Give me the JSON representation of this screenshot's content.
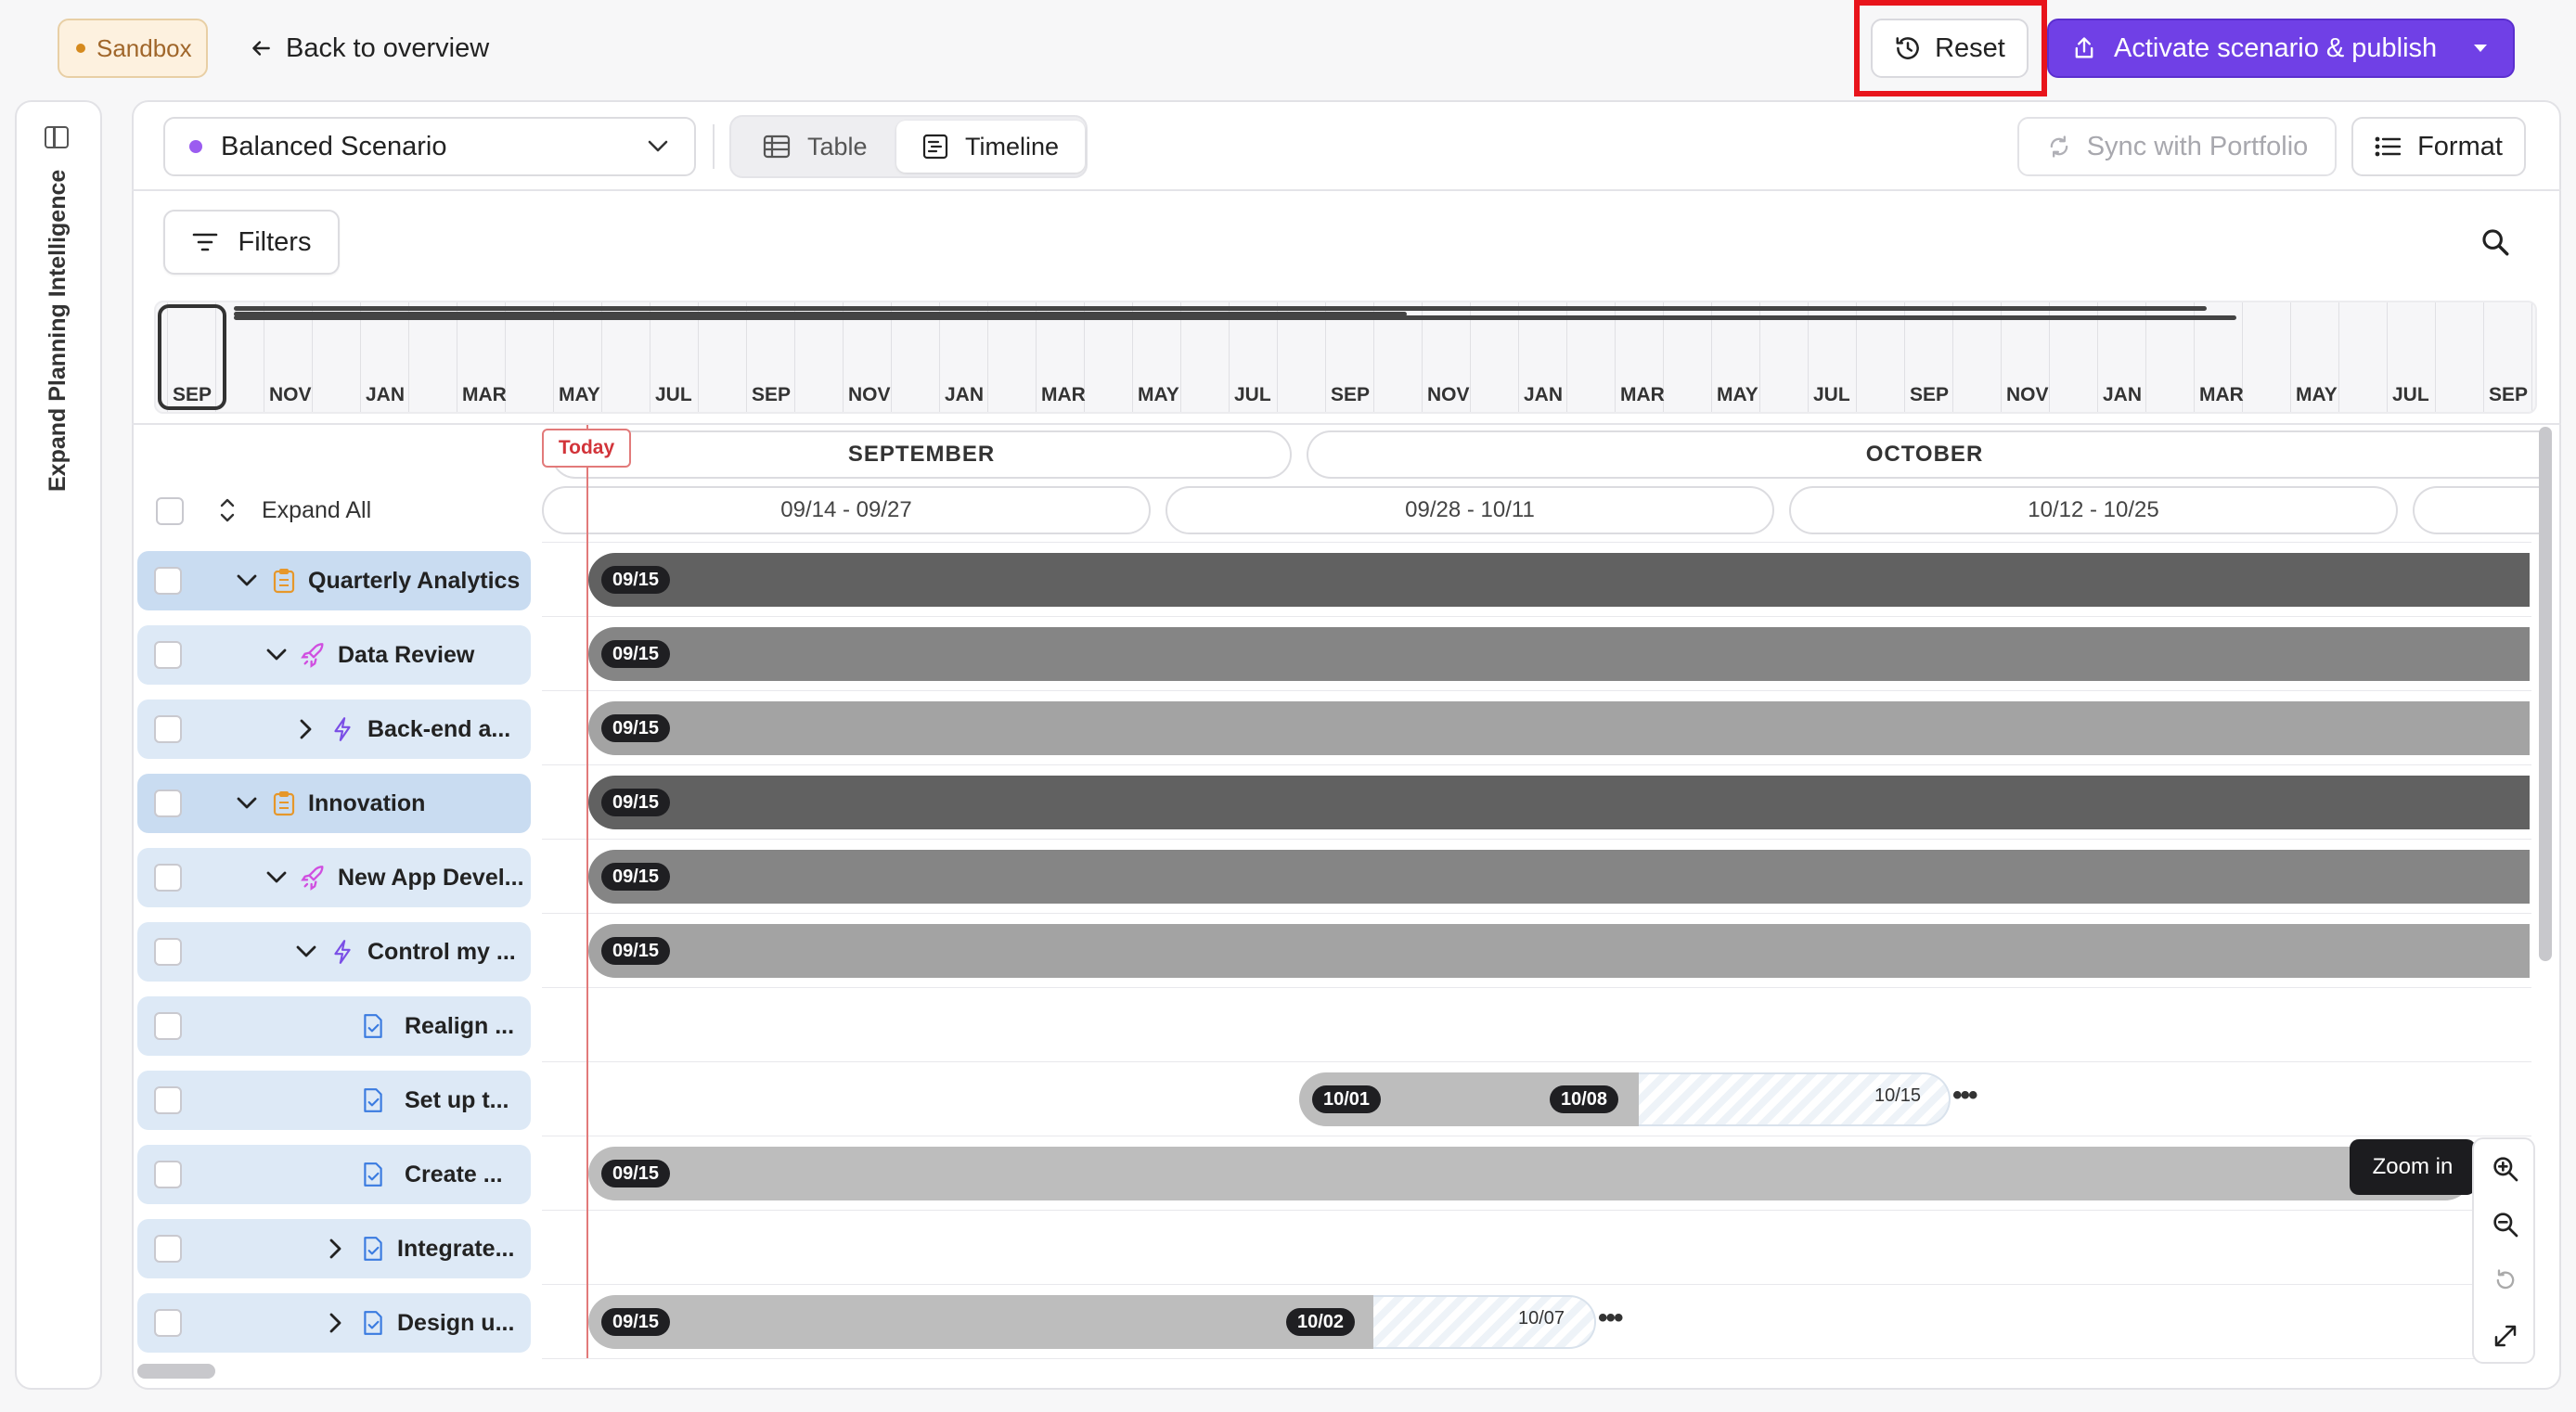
{
  "topbar": {
    "sandbox_label": "Sandbox",
    "back_label": "Back to overview",
    "reset_label": "Reset",
    "activate_label": "Activate scenario & publish"
  },
  "sidebar": {
    "expand_label": "Expand Planning Intelligence"
  },
  "toolbar": {
    "scenario_name": "Balanced Scenario",
    "tab_table": "Table",
    "tab_timeline": "Timeline",
    "sync_label": "Sync with Portfolio",
    "format_label": "Format",
    "filters_label": "Filters"
  },
  "minimap": {
    "months": [
      "SEP",
      "NOV",
      "JAN",
      "MAR",
      "MAY",
      "JUL",
      "SEP",
      "NOV",
      "JAN",
      "MAR",
      "MAY",
      "JUL",
      "SEP",
      "NOV",
      "JAN",
      "MAR",
      "MAY",
      "JUL",
      "SEP",
      "NOV",
      "JAN",
      "MAR",
      "MAY",
      "JUL",
      "SEP"
    ]
  },
  "timeline": {
    "today_label": "Today",
    "months": [
      "SEPTEMBER",
      "OCTOBER"
    ],
    "ranges": [
      "09/14 - 09/27",
      "09/28 - 10/11",
      "10/12 - 10/25"
    ],
    "expand_all_label": "Expand All"
  },
  "rows": [
    {
      "label": "Quarterly Analytics",
      "start": "09/15"
    },
    {
      "label": "Data Review",
      "start": "09/15"
    },
    {
      "label": "Back-end a...",
      "start": "09/15"
    },
    {
      "label": "Innovation",
      "start": "09/15"
    },
    {
      "label": "New App Devel...",
      "start": "09/15"
    },
    {
      "label": "Control my ...",
      "start": "09/15"
    },
    {
      "label": "Realign ..."
    },
    {
      "label": "Set up t...",
      "start": "10/01",
      "mid": "10/08",
      "end": "10/15"
    },
    {
      "label": "Create ...",
      "start": "09/15"
    },
    {
      "label": "Integrate..."
    },
    {
      "label": "Design u...",
      "start": "09/15",
      "mid": "10/02",
      "end": "10/07"
    }
  ],
  "zoom": {
    "tooltip": "Zoom in"
  },
  "colors": {
    "accent": "#7040e6",
    "reset_highlight": "#e8141b",
    "today": "#e27a7a"
  }
}
